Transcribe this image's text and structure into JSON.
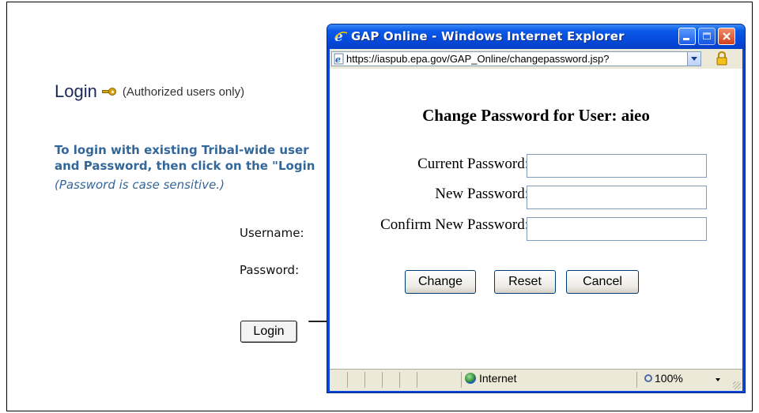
{
  "login_page": {
    "title": "Login",
    "auth_note": "(Authorized users only)",
    "instructions_line1": "To login with existing Tribal-wide user",
    "instructions_line2": "and Password, then click on the \"Login",
    "case_note": "(Password is case sensitive.)",
    "username_label": "Username:",
    "password_label": "Password:",
    "login_button": "Login"
  },
  "ie_window": {
    "title": "GAP Online - Windows Internet Explorer",
    "url": "https://iaspub.epa.gov/GAP_Online/changepassword.jsp?",
    "page": {
      "heading": "Change Password for User: aieo",
      "current_password_label": "Current Password:",
      "new_password_label": "New Password:",
      "confirm_password_label": "Confirm New Password:",
      "current_password_value": "",
      "new_password_value": "",
      "confirm_password_value": "",
      "change_button": "Change",
      "reset_button": "Reset",
      "cancel_button": "Cancel"
    },
    "status": {
      "zone": "Internet",
      "zoom": "100%"
    }
  },
  "colors": {
    "titlebar_blue": "#0a5ae8",
    "instruction_text": "#336699",
    "close_button": "#d2401c"
  },
  "icons": [
    "ie-logo-icon",
    "key-icon",
    "page-icon",
    "lock-icon",
    "globe-icon",
    "zoom-icon",
    "minimize-icon",
    "maximize-icon",
    "close-icon"
  ]
}
